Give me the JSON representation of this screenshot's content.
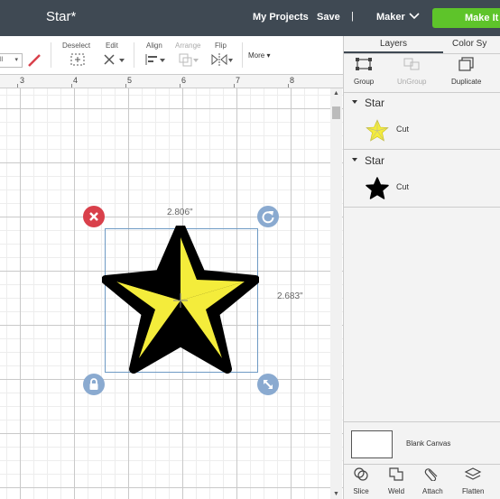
{
  "header": {
    "project_title": "Star*",
    "my_projects": "My Projects",
    "save": "Save",
    "separator": "|",
    "machine": "Maker",
    "make_it": "Make It"
  },
  "toolbar": {
    "fill_value": "ll",
    "deselect": "Deselect",
    "edit": "Edit",
    "align": "Align",
    "arrange": "Arrange",
    "flip": "Flip",
    "more": "More"
  },
  "ruler": {
    "marks": [
      "3",
      "4",
      "5",
      "6",
      "7",
      "8"
    ]
  },
  "canvas": {
    "width_readout": "2.806\"",
    "height_readout": "2.683\""
  },
  "panel": {
    "tabs": {
      "layers": "Layers",
      "color_sync": "Color Sy"
    },
    "actions": {
      "group": "Group",
      "ungroup": "UnGroup",
      "duplicate": "Duplicate"
    },
    "groups": [
      {
        "name": "Star",
        "layer_label": "Cut",
        "icon": "yellow-star-thumbnail"
      },
      {
        "name": "Star",
        "layer_label": "Cut",
        "icon": "black-star-thumbnail"
      }
    ],
    "blank_canvas": "Blank Canvas",
    "footer": {
      "slice": "Slice",
      "weld": "Weld",
      "attach": "Attach",
      "flatten": "Flatten"
    }
  },
  "colors": {
    "header_bg": "#3f4953",
    "make_it_green": "#5ec42a",
    "star_yellow": "#f4ec3b",
    "delete_handle": "#d9404b",
    "handle_blue": "#8aaad0"
  }
}
